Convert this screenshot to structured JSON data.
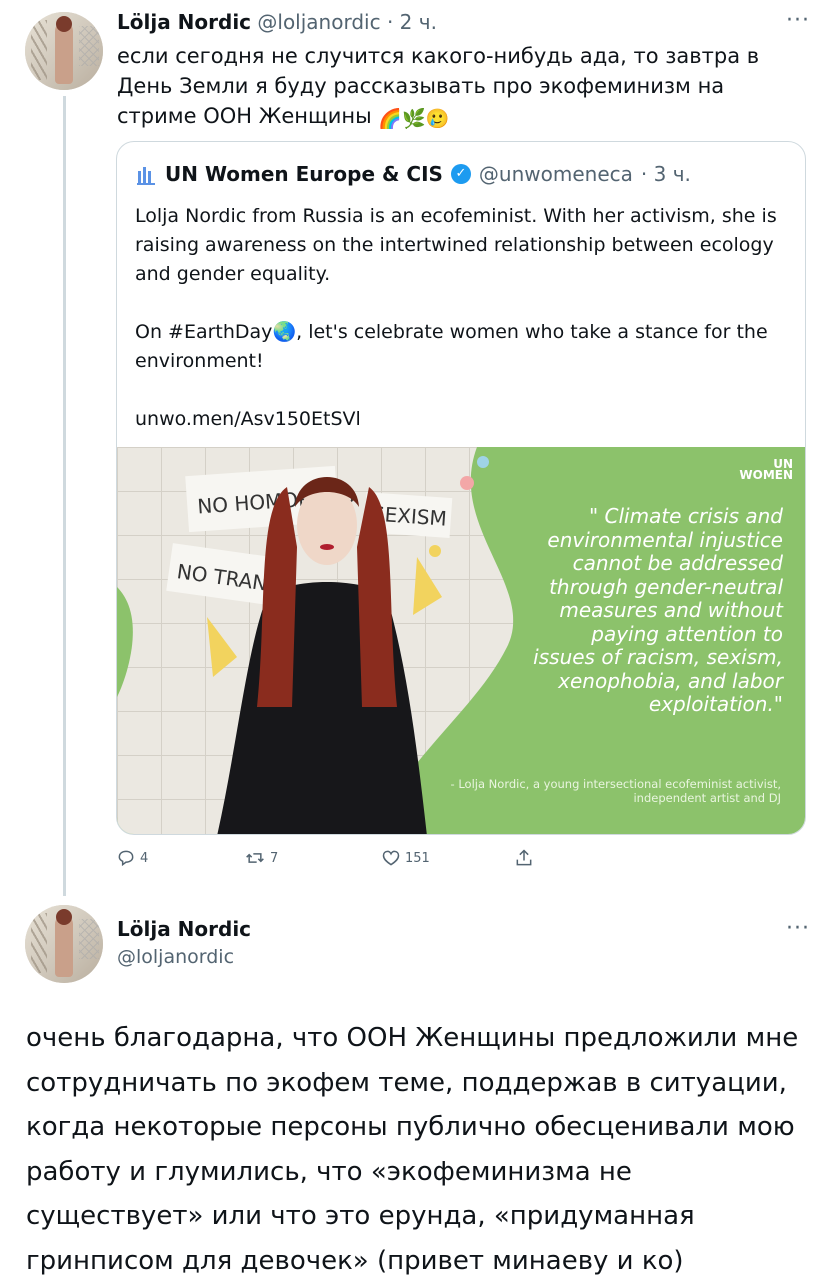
{
  "tweet1": {
    "name": "Lölja Nordic",
    "handle": "@loljanordic",
    "time": "· 2 ч.",
    "more": "···",
    "text": "если сегодня не случится какого-нибудь ада, то завтра в День Земли я буду рассказывать про экофеминизм на стриме ООН Женщины",
    "emojis": [
      "🌈",
      "🌿",
      "🥲"
    ]
  },
  "quote": {
    "name": "UN Women Europe & CIS",
    "verified_icon": "verified-badge",
    "handle": "@unwomeneca",
    "time": "· 3 ч.",
    "paragraph1": "Lolja Nordic from Russia is an ecofeminist. With her activism, she is raising awareness on the intertwined relationship between ecology and gender equality.",
    "paragraph2_text": "On #EarthDay",
    "paragraph2_emoji": "🌏",
    "paragraph2_rest": ", let's celebrate women who take a stance for the environment!",
    "link": "unwo.men/Asv150EtSVl",
    "image": {
      "logo_line1": "UN",
      "logo_line2": "WOMEN",
      "sign1": "NO HOMOPHOB",
      "sign2": "SEXISM",
      "sign3": "NO TRAN",
      "quote_text": "\" Climate crisis and environmental injustice cannot be addressed through gender-neutral measures and without paying attention to issues of racism, sexism, xenophobia, and labor exploitation.\"",
      "credit": "- Lolja Nordic, a young intersectional ecofeminist activist, independent artist and DJ"
    }
  },
  "actions": {
    "reply_count": "4",
    "retweet_count": "7",
    "like_count": "151",
    "icons": [
      "reply-icon",
      "retweet-icon",
      "like-icon",
      "share-icon"
    ]
  },
  "tweet2": {
    "name": "Lölja Nordic",
    "handle": "@loljanordic",
    "more": "···",
    "text": "очень благодарна, что ООН Женщины предложили мне сотрудничать по экофем теме, поддержав в ситуации, когда некоторые персоны публично обесценивали мою работу и глумились, что «экофеминизма не существует» или что это ерунда, «придуманная гринписом для девочек» (привет минаеву и ко)"
  },
  "colors": {
    "text": "#0f1419",
    "muted": "#536471",
    "border": "#cfd9de",
    "verified": "#1d9bf0",
    "promo_green": "#8cc26b"
  }
}
